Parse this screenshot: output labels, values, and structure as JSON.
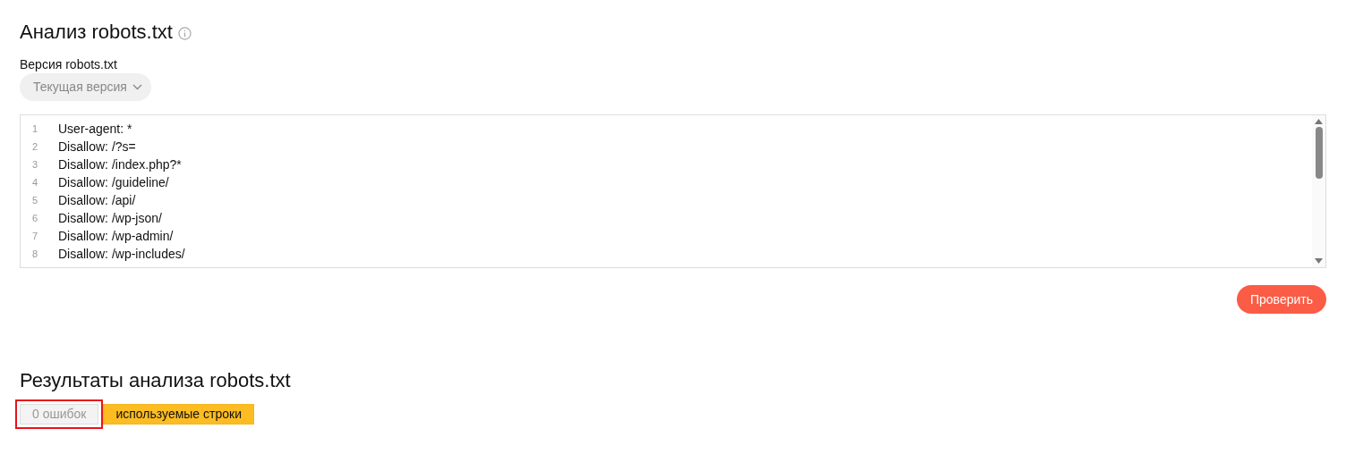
{
  "title": "Анализ robots.txt",
  "version": {
    "label": "Версия robots.txt",
    "value": "Текущая версия"
  },
  "editor": {
    "lines": [
      {
        "number": "1",
        "text": "User-agent: *"
      },
      {
        "number": "2",
        "text": "Disallow: /?s="
      },
      {
        "number": "3",
        "text": "Disallow: /index.php?*"
      },
      {
        "number": "4",
        "text": "Disallow: /guideline/"
      },
      {
        "number": "5",
        "text": "Disallow: /api/"
      },
      {
        "number": "6",
        "text": "Disallow: /wp-json/"
      },
      {
        "number": "7",
        "text": "Disallow: /wp-admin/"
      },
      {
        "number": "8",
        "text": "Disallow: /wp-includes/"
      }
    ]
  },
  "check_button": "Проверить",
  "results": {
    "title": "Результаты анализа robots.txt",
    "tabs": [
      {
        "label": "0 ошибок",
        "selected": false,
        "highlighted": true
      },
      {
        "label": "используемые строки",
        "selected": true,
        "highlighted": false
      }
    ]
  }
}
